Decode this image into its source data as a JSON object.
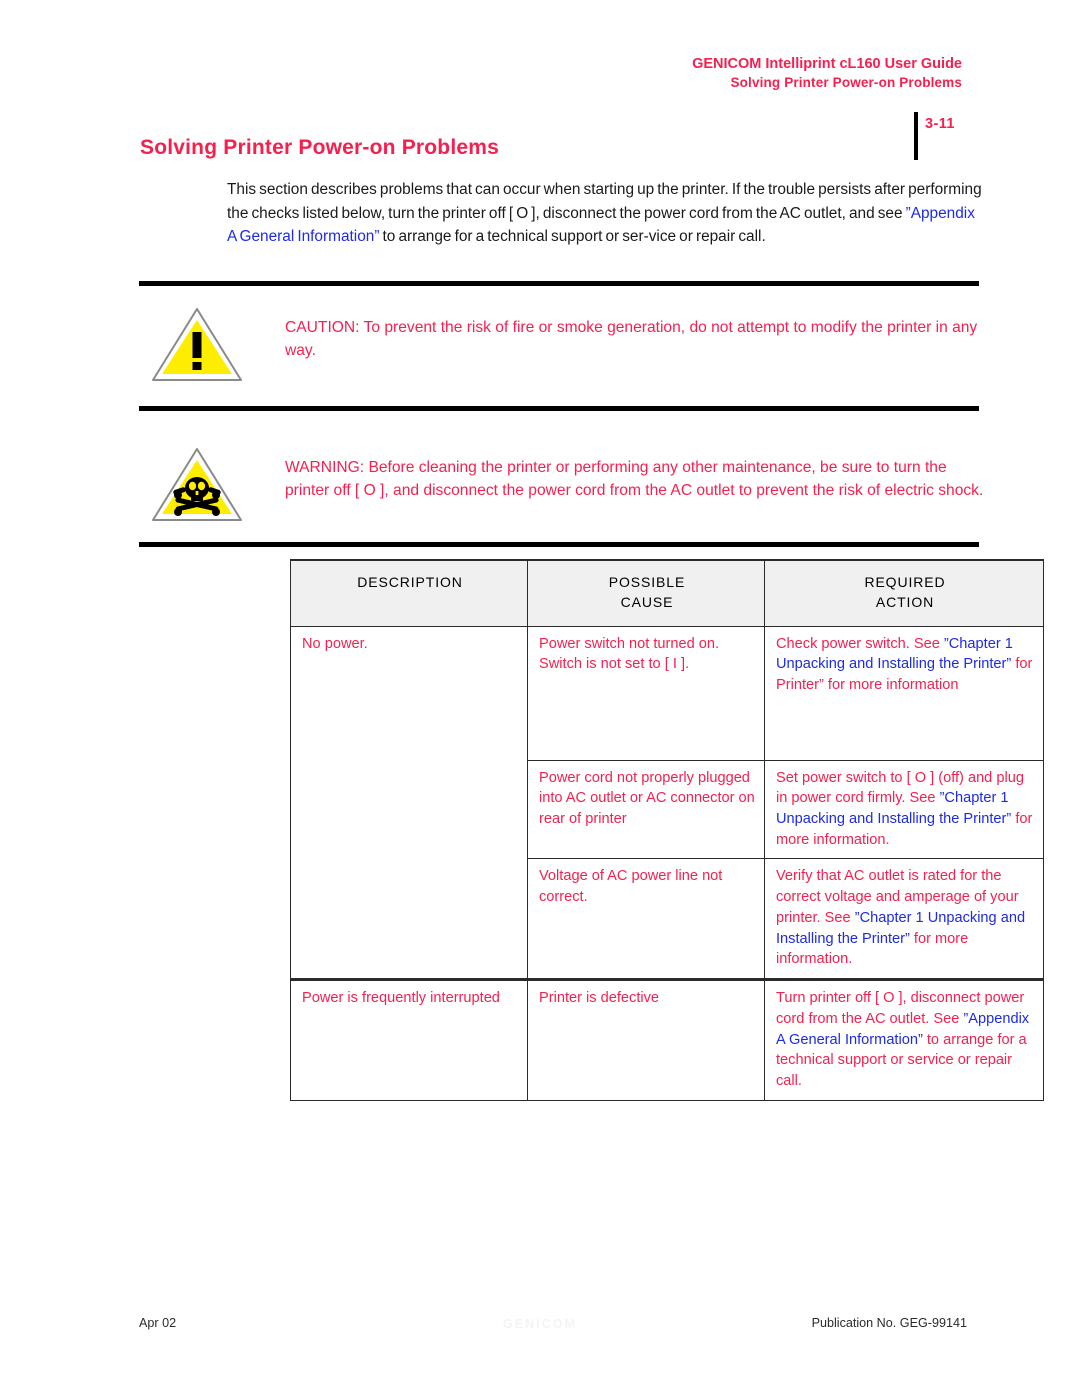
{
  "header": {
    "guide_title": "GENICOM Intelliprint cL160 User Guide",
    "section_subtitle": "Solving Printer Power-on Problems",
    "page_number": "3-11"
  },
  "section": {
    "title": "Solving Printer Power-on Problems",
    "intro_part1": "This section describes problems that can occur when starting up the printer. If the trouble persists after performing the checks listed below, turn the printer off [ O ], disconnect the power cord from the AC outlet, and see ",
    "intro_link": "”Appendix A General Information”",
    "intro_part2": " to arrange for a technical support or ser-vice or repair call."
  },
  "admonitions": [
    {
      "id": "caution",
      "icon": "warning-triangle-exclamation-icon",
      "text": "CAUTION: To prevent the risk of fire or smoke generation, do not attempt to modify the printer in any way."
    },
    {
      "id": "warning",
      "icon": "warning-triangle-skull-icon",
      "text": "WARNING: Before cleaning the printer or performing any other maintenance, be sure to turn the printer off [ O ], and disconnect the power cord from the AC outlet to prevent the risk of electric shock."
    }
  ],
  "table": {
    "headers": [
      "DESCRIPTION",
      "POSSIBLE\nCAUSE",
      "REQUIRED\nACTION"
    ],
    "headers_display": {
      "description": "DESCRIPTION",
      "cause_line1": "POSSIBLE",
      "cause_line2": "CAUSE",
      "action_line1": "REQUIRED",
      "action_line2": "ACTION"
    },
    "rows": [
      {
        "description": "No power.",
        "cause": "Power switch not turned on. Switch is not set to [ I ].",
        "action_part1": "Check power switch. See ",
        "action_link": "”Chapter 1 Unpacking and Installing the Printer”",
        "action_part2": " for Printer” for more information"
      },
      {
        "description": "",
        "cause": "Power cord not properly plugged into AC outlet or AC connector on rear of printer",
        "action_part1": "Set power switch to [ O ] (off) and plug in power cord firmly. See ",
        "action_link": "”Chapter 1 Unpacking and Installing the Printer”",
        "action_part2": " for more information."
      },
      {
        "description": "",
        "cause": "Voltage of AC power line not correct.",
        "action_part1": "Verify that AC outlet is rated for the correct voltage and amperage of your printer. See ",
        "action_link": "”Chapter 1 Unpacking and Installing the Printer”",
        "action_part2": " for more information."
      },
      {
        "description": "Power is frequently interrupted",
        "cause": "Printer is defective",
        "action_part1": "Turn printer off [ O ], disconnect power cord from the AC outlet. See ",
        "action_link": "”Appendix A General Information”",
        "action_part2": " to arrange for a technical support or service or repair call."
      }
    ]
  },
  "footer": {
    "date": "Apr 02",
    "watermark": "GENICOM",
    "publication": "Publication No. GEG-99141"
  },
  "colors": {
    "accent_red": "#f4214f",
    "link_blue": "#1d2ae8",
    "header_fill": "#f0f0f0",
    "rule_black": "#000000",
    "warning_yellow": "#ffed00"
  }
}
